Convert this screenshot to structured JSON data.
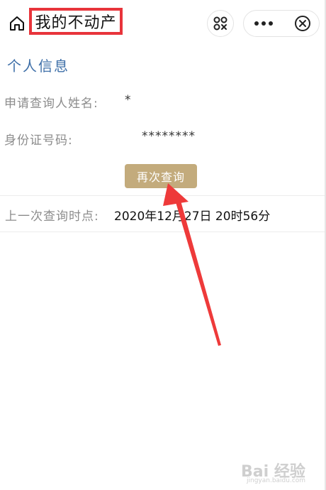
{
  "header": {
    "title": "我的不动产"
  },
  "section": {
    "title": "个人信息"
  },
  "fields": {
    "applicant_label": "申请查询人姓名:",
    "applicant_value": "*",
    "id_label": "身份证号码:",
    "id_value": "********"
  },
  "actions": {
    "query_again": "再次查询"
  },
  "last_query": {
    "label": "上一次查询时点:",
    "value": "2020年12月27日 20时56分"
  },
  "watermark": {
    "logo": "Bai 经验",
    "url": "jingyan.baidu.com"
  },
  "colors": {
    "section_title": "#3e6fa8",
    "button": "#c3ab7c",
    "highlight": "#e8343b"
  }
}
